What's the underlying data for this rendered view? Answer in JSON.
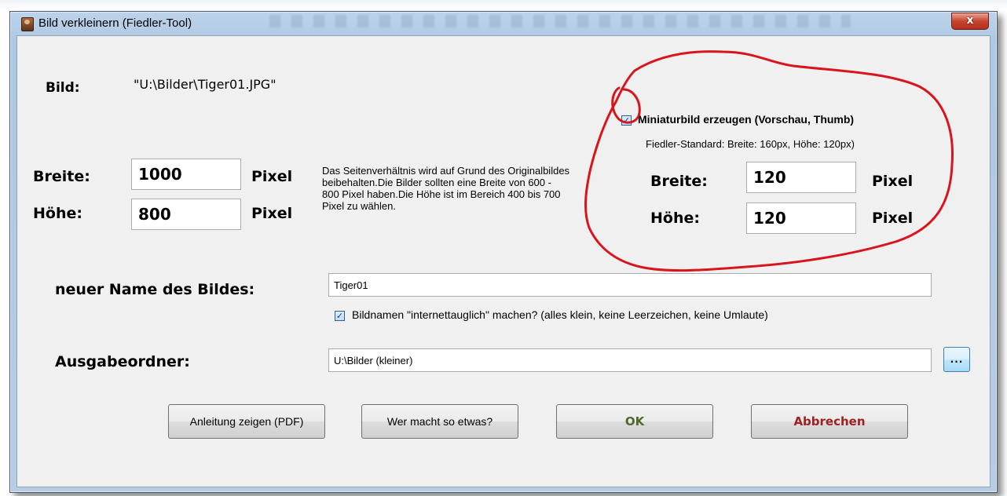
{
  "window": {
    "title": "Bild verkleinern (Fiedler-Tool)",
    "close_label": "x"
  },
  "image": {
    "label": "Bild:",
    "path": "\"U:\\Bilder\\Tiger01.JPG\""
  },
  "size": {
    "width_label": "Breite:",
    "width_value": "1000",
    "height_label": "Höhe:",
    "height_value": "800",
    "unit": "Pixel",
    "hint": "Das Seitenverhältnis wird auf Grund des Originalbildes beibehalten.Die Bilder sollten eine Breite von 600 - 800 Pixel haben.Die Höhe ist im Bereich 400 bis 700 Pixel zu wählen."
  },
  "thumb": {
    "checkbox_label": "Miniaturbild erzeugen (Vorschau, Thumb)",
    "checked": true,
    "standard_text": "Fiedler-Standard: Breite: 160px, Höhe: 120px)",
    "width_label": "Breite:",
    "width_value": "120",
    "height_label": "Höhe:",
    "height_value": "120",
    "unit": "Pixel"
  },
  "name": {
    "label": "neuer Name des Bildes:",
    "value": "Tiger01",
    "web_checkbox_label": "Bildnamen \"internettauglich\" machen? (alles klein, keine Leerzeichen, keine Umlaute)",
    "web_checked": true
  },
  "output": {
    "label": "Ausgabeordner:",
    "value": "U:\\Bilder (kleiner)",
    "browse_label": "..."
  },
  "buttons": {
    "manual": "Anleitung zeigen (PDF)",
    "who": "Wer macht so etwas?",
    "ok": "OK",
    "cancel": "Abbrechen"
  },
  "colors": {
    "ok_text": "#4f6a2a",
    "cancel_text": "#a02020",
    "annotation": "#d8141c"
  },
  "icons": {
    "check": "✓"
  }
}
